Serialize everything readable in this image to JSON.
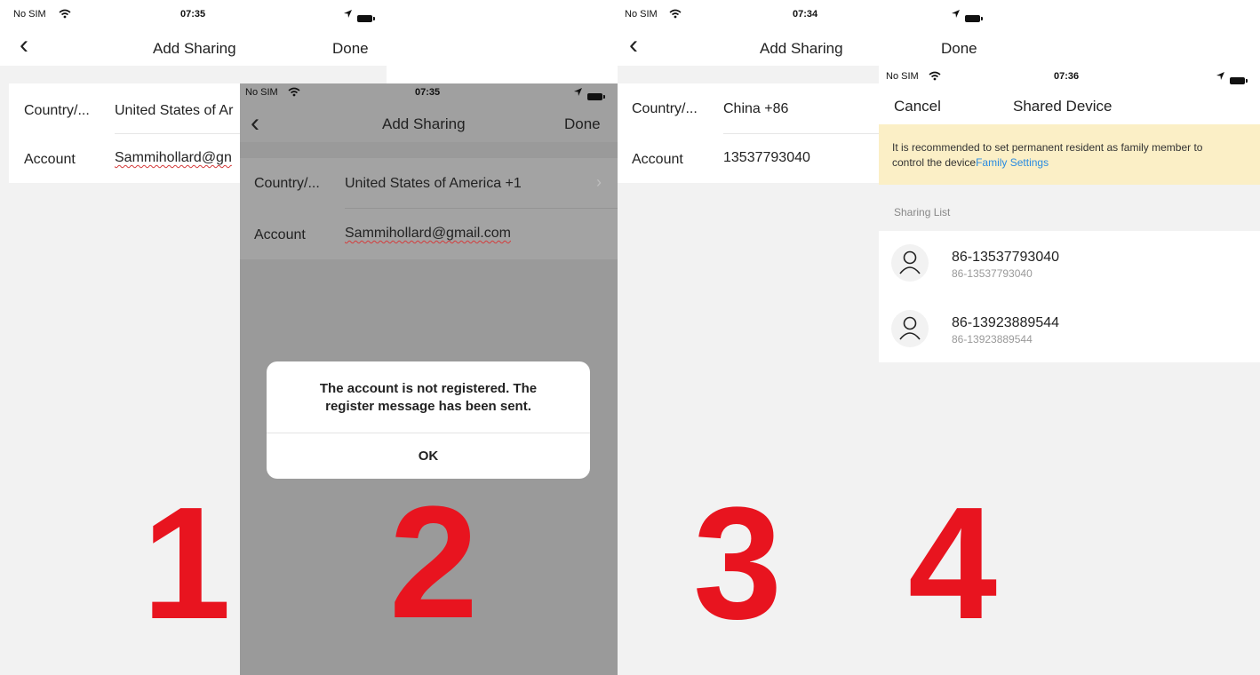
{
  "screen1": {
    "status": {
      "carrier": "No SIM",
      "time": "07:35"
    },
    "nav": {
      "back": "‹",
      "title": "Add Sharing",
      "done": "Done"
    },
    "rows": [
      {
        "label": "Country/...",
        "value": "United States of Ar"
      },
      {
        "label": "Account",
        "value": "Sammihollard@gn"
      }
    ],
    "step": "1"
  },
  "screen2": {
    "status": {
      "carrier": "No SIM",
      "time": "07:35"
    },
    "nav": {
      "back": "‹",
      "title": "Add Sharing",
      "done": "Done"
    },
    "rows": [
      {
        "label": "Country/...",
        "value": "United States of America +1",
        "chevron": "›"
      },
      {
        "label": "Account",
        "value": "Sammihollard@gmail.com"
      }
    ],
    "alert": {
      "message_line1": "The account is not registered. The",
      "message_line2": "register message has been sent.",
      "ok": "OK"
    },
    "step": "2"
  },
  "screen3": {
    "status": {
      "carrier": "No SIM",
      "time": "07:34"
    },
    "nav": {
      "back": "‹",
      "title": "Add Sharing",
      "done": "Done"
    },
    "rows": [
      {
        "label": "Country/...",
        "value": "China +86"
      },
      {
        "label": "Account",
        "value": "13537793040"
      }
    ],
    "step": "3"
  },
  "screen4": {
    "status": {
      "carrier": "No SIM",
      "time": "07:36"
    },
    "nav": {
      "cancel": "Cancel",
      "title": "Shared Device"
    },
    "banner": {
      "text": "It is recommended to set permanent resident as family member to control the device",
      "link": "Family Settings"
    },
    "section_header": "Sharing List",
    "list": [
      {
        "name": "86-13537793040",
        "sub": "86-13537793040"
      },
      {
        "name": "86-13923889544",
        "sub": "86-13923889544"
      }
    ],
    "step": "4"
  },
  "colors": {
    "step_number": "#e8141f",
    "banner_bg": "#fbefc6",
    "link": "#2a8be0",
    "dim_overlay": "#9a9a9a"
  }
}
